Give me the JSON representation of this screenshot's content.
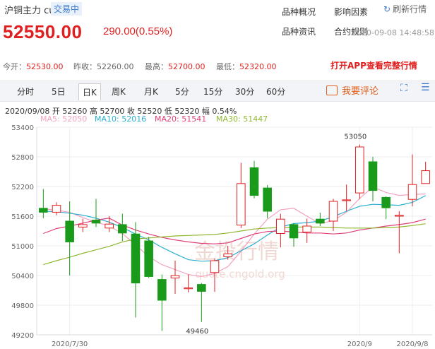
{
  "header": {
    "title": "沪铜主力 cum",
    "tag": "交易中",
    "price": "52550.00",
    "change": "290.00(0.55%)",
    "links": [
      "品种概况",
      "影响因素",
      "品种资讯",
      "合约规则"
    ],
    "refresh": "刷新行情",
    "time": "2020-09-08 14:48:58"
  },
  "quote": {
    "open_label": "今开：",
    "open": "52530.00",
    "prev_label": "昨收：",
    "prev": "52260.00",
    "high_label": "最高：",
    "high": "52700.00",
    "low_label": "最低：",
    "low": "52320.00",
    "app_promo": "打开APP查看完整行情"
  },
  "tabs": [
    "分时",
    "5日",
    "日K",
    "周K",
    "月K",
    "5分",
    "15分",
    "30分",
    "60分"
  ],
  "active_tab": "日K",
  "comment_button": "我要评论",
  "info_line": "2020/09/08  开 52260  高 52700  收 52520  低 52320  幅 0.54%",
  "ma_labels": [
    {
      "text": "MA5: 52050",
      "color": "#f4a3c0"
    },
    {
      "text": "MA10: 52016",
      "color": "#2ab0d0"
    },
    {
      "text": "MA20: 51541",
      "color": "#e0407a"
    },
    {
      "text": "MA30: 51447",
      "color": "#8fb830"
    }
  ],
  "watermark": {
    "cn": "金投行情",
    "en": "quote.cngold.org"
  },
  "colors": {
    "up": "#e02020",
    "down": "#1a9a1a",
    "ma5": "#f4a3c0",
    "ma10": "#2ab0d0",
    "ma20": "#e0407a",
    "ma30": "#8fb830"
  },
  "chart_data": {
    "type": "candlestick",
    "ylim": [
      49200,
      53400
    ],
    "yticks": [
      53400,
      52800,
      52200,
      51600,
      51000,
      50400,
      49800,
      49200
    ],
    "xticks": [
      "2020/7/30",
      "2020/9",
      "2020/9/8"
    ],
    "xtick_index": [
      2,
      24,
      28
    ],
    "annotations": [
      {
        "text": "53050",
        "index": 24
      },
      {
        "text": "49460",
        "index": 12
      }
    ],
    "candles": [
      {
        "o": 51760,
        "c": 51680,
        "h": 52150,
        "l": 51560
      },
      {
        "o": 51680,
        "c": 51820,
        "h": 51880,
        "l": 51620
      },
      {
        "o": 51500,
        "c": 51080,
        "h": 51900,
        "l": 50400
      },
      {
        "o": 51380,
        "c": 51430,
        "h": 51550,
        "l": 51280
      },
      {
        "o": 51520,
        "c": 51460,
        "h": 51950,
        "l": 51380
      },
      {
        "o": 51360,
        "c": 51440,
        "h": 51600,
        "l": 51280
      },
      {
        "o": 51430,
        "c": 51260,
        "h": 51650,
        "l": 51100
      },
      {
        "o": 51240,
        "c": 50250,
        "h": 51480,
        "l": 49550
      },
      {
        "o": 51100,
        "c": 50380,
        "h": 51180,
        "l": 50350
      },
      {
        "o": 50320,
        "c": 49900,
        "h": 50420,
        "l": 49280
      },
      {
        "o": 50350,
        "c": 50400,
        "h": 50700,
        "l": 50030
      },
      {
        "o": 50150,
        "c": 50150,
        "h": 50420,
        "l": 50060
      },
      {
        "o": 50220,
        "c": 50080,
        "h": 50250,
        "l": 49460
      },
      {
        "o": 50460,
        "c": 50700,
        "h": 50750,
        "l": 50070
      },
      {
        "o": 50780,
        "c": 50840,
        "h": 51000,
        "l": 50720
      },
      {
        "o": 51420,
        "c": 52260,
        "h": 52680,
        "l": 51360
      },
      {
        "o": 52580,
        "c": 52020,
        "h": 52720,
        "l": 51960
      },
      {
        "o": 52170,
        "c": 51700,
        "h": 52230,
        "l": 51560
      },
      {
        "o": 51250,
        "c": 51540,
        "h": 51650,
        "l": 50970
      },
      {
        "o": 51430,
        "c": 51160,
        "h": 51460,
        "l": 50980
      },
      {
        "o": 51280,
        "c": 51400,
        "h": 51550,
        "l": 51060
      },
      {
        "o": 51540,
        "c": 51460,
        "h": 51670,
        "l": 51400
      },
      {
        "o": 51500,
        "c": 51900,
        "h": 51950,
        "l": 51300
      },
      {
        "o": 51930,
        "c": 51930,
        "h": 52240,
        "l": 51700
      },
      {
        "o": 52070,
        "c": 53000,
        "h": 53050,
        "l": 51950
      },
      {
        "o": 52700,
        "c": 52120,
        "h": 52800,
        "l": 51900
      },
      {
        "o": 51980,
        "c": 51770,
        "h": 52000,
        "l": 51540
      },
      {
        "o": 51600,
        "c": 51620,
        "h": 51700,
        "l": 50850
      },
      {
        "o": 51940,
        "c": 52240,
        "h": 52850,
        "l": 51800
      },
      {
        "o": 52260,
        "c": 52520,
        "h": 52700,
        "l": 52320
      }
    ],
    "series": [
      {
        "name": "MA5",
        "values": [
          51750,
          51720,
          51680,
          51570,
          51480,
          51400,
          51250,
          51020,
          50780,
          50620,
          50520,
          50420,
          50380,
          50440,
          50580,
          50890,
          51240,
          51540,
          51730,
          51760,
          51600,
          51450,
          51510,
          51680,
          51960,
          52190,
          52080,
          52020,
          52040,
          52050
        ]
      },
      {
        "name": "MA10",
        "values": [
          51700,
          51690,
          51660,
          51620,
          51560,
          51480,
          51370,
          51240,
          51120,
          50970,
          50840,
          50720,
          50690,
          50700,
          50760,
          50900,
          51040,
          51220,
          51380,
          51450,
          51470,
          51500,
          51590,
          51700,
          51800,
          51840,
          51830,
          51820,
          51880,
          52016
        ]
      },
      {
        "name": "MA20",
        "values": [
          51250,
          51350,
          51400,
          51460,
          51520,
          51560,
          51420,
          51320,
          51240,
          51170,
          51120,
          51080,
          51050,
          51040,
          51060,
          51150,
          51240,
          51290,
          51300,
          51280,
          51260,
          51260,
          51240,
          51260,
          51320,
          51360,
          51400,
          51430,
          51470,
          51541
        ]
      },
      {
        "name": "MA30",
        "values": [
          50620,
          50700,
          50770,
          50850,
          50920,
          50990,
          51080,
          51140,
          51160,
          51180,
          51200,
          51210,
          51220,
          51230,
          51260,
          51300,
          51340,
          51360,
          51370,
          51380,
          51380,
          51380,
          51370,
          51360,
          51360,
          51360,
          51370,
          51380,
          51410,
          51447
        ]
      }
    ]
  }
}
